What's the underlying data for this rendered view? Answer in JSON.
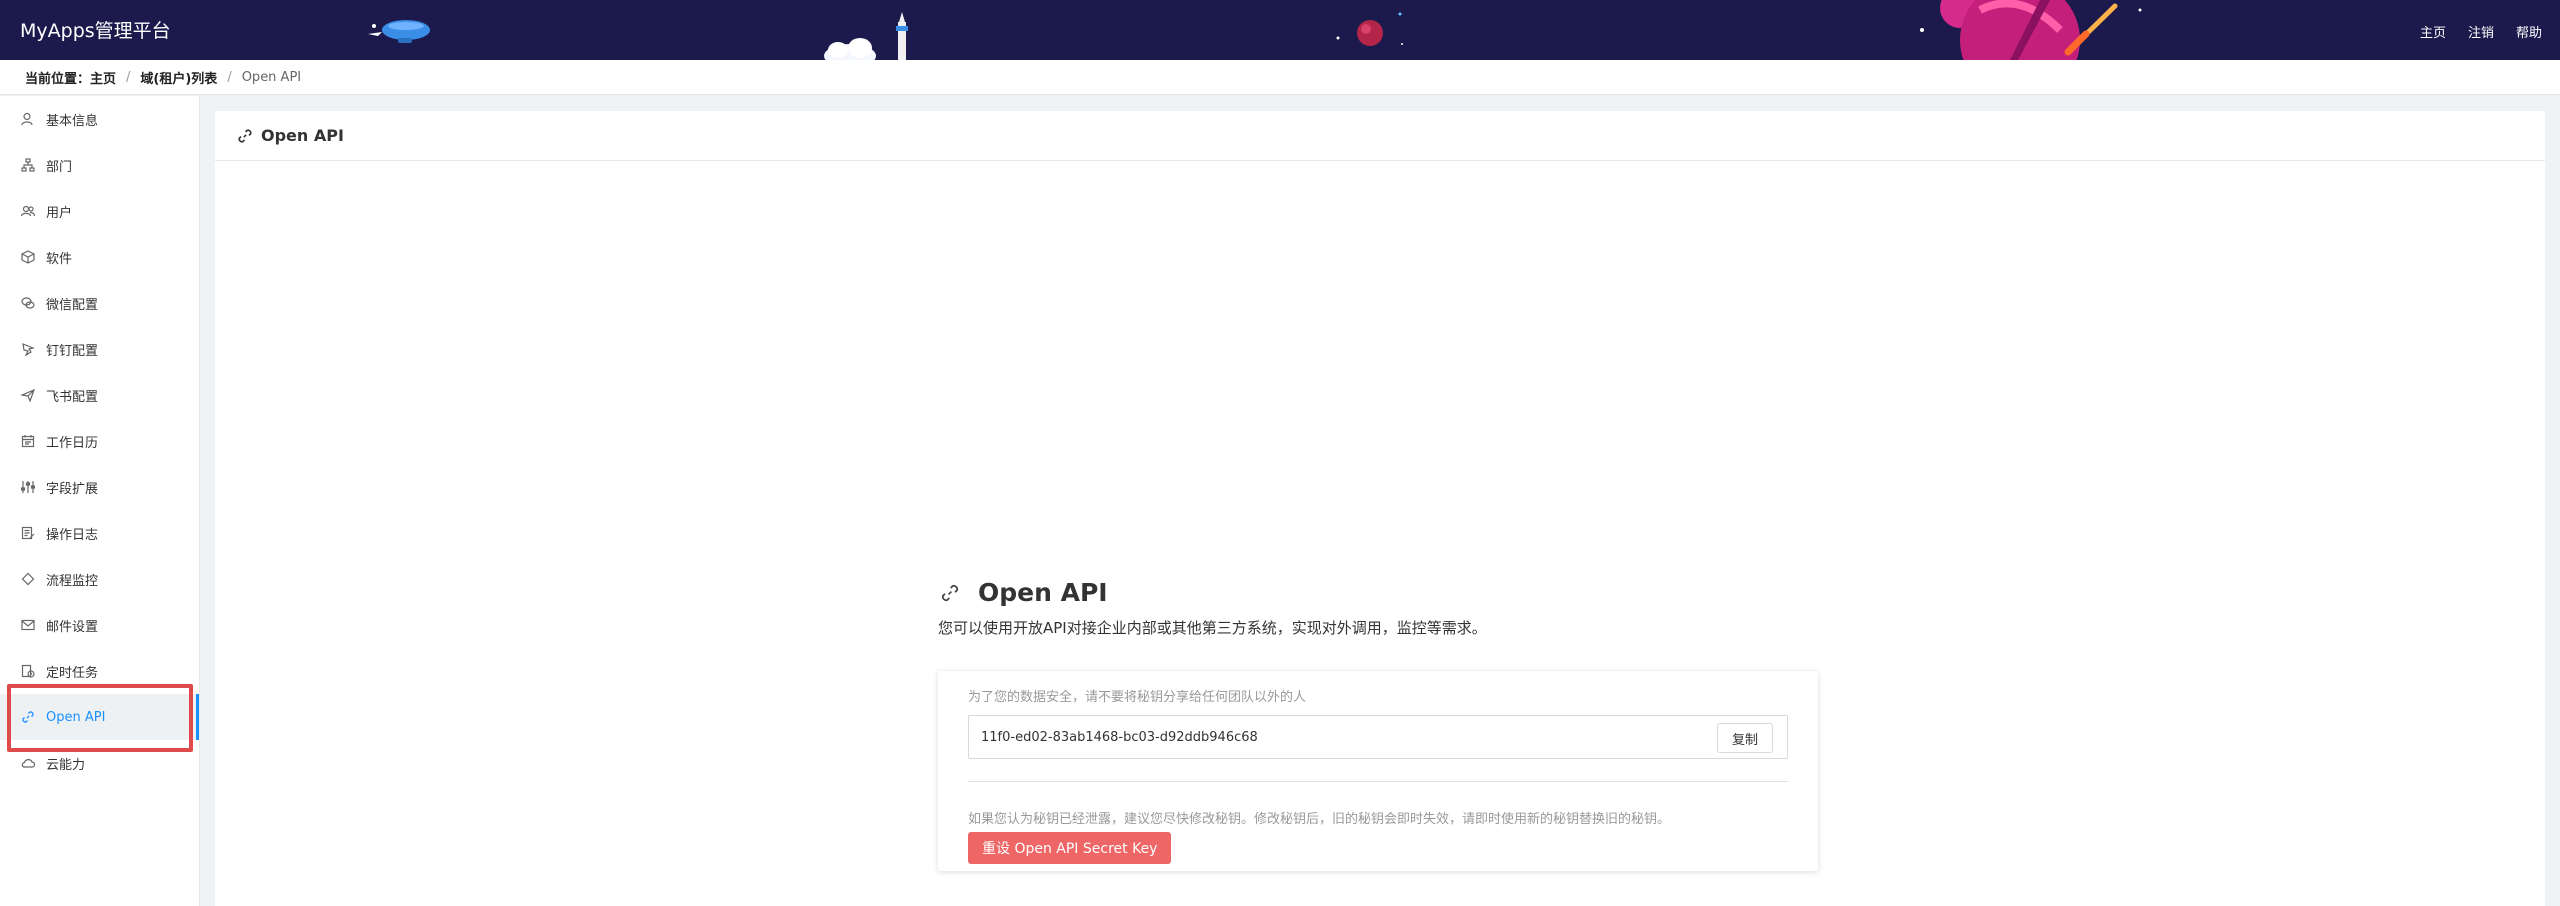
{
  "header": {
    "brand": "MyApps管理平台",
    "links": [
      "主页",
      "注销",
      "帮助"
    ]
  },
  "breadcrumb": {
    "prefix": "当前位置：",
    "items": [
      "主页",
      "域(租户)列表",
      "Open API"
    ]
  },
  "sidebar": {
    "items": [
      {
        "label": "基本信息",
        "icon": "user-icon"
      },
      {
        "label": "部门",
        "icon": "org-chart-icon"
      },
      {
        "label": "用户",
        "icon": "users-icon"
      },
      {
        "label": "软件",
        "icon": "cube-icon"
      },
      {
        "label": "微信配置",
        "icon": "wechat-icon"
      },
      {
        "label": "钉钉配置",
        "icon": "dingtalk-icon"
      },
      {
        "label": "飞书配置",
        "icon": "feishu-icon"
      },
      {
        "label": "工作日历",
        "icon": "calendar-icon"
      },
      {
        "label": "字段扩展",
        "icon": "sliders-icon"
      },
      {
        "label": "操作日志",
        "icon": "log-icon"
      },
      {
        "label": "流程监控",
        "icon": "diamond-icon"
      },
      {
        "label": "邮件设置",
        "icon": "mail-icon"
      },
      {
        "label": "定时任务",
        "icon": "timer-icon"
      },
      {
        "label": "Open API",
        "icon": "link-icon",
        "active": true
      },
      {
        "label": "云能力",
        "icon": "cloud-icon"
      }
    ]
  },
  "card": {
    "title": "Open API"
  },
  "api": {
    "title": "Open API",
    "description": "您可以使用开放API对接企业内部或其他第三方系统，实现对外调用，监控等需求。",
    "warning": "为了您的数据安全，请不要将秘钥分享给任何团队以外的人",
    "key": "11f0-ed02-83ab1468-bc03-d92ddb946c68",
    "copy_label": "复制",
    "hint": "如果您认为秘钥已经泄露，建议您尽快修改秘钥。修改秘钥后，旧的秘钥会即时失效，请即时使用新的秘钥替换旧的秘钥。",
    "reset_label": "重设 Open API Secret Key"
  },
  "colors": {
    "header_bg": "#1c1a4c",
    "accent": "#1890ff",
    "danger": "#ee6666"
  }
}
